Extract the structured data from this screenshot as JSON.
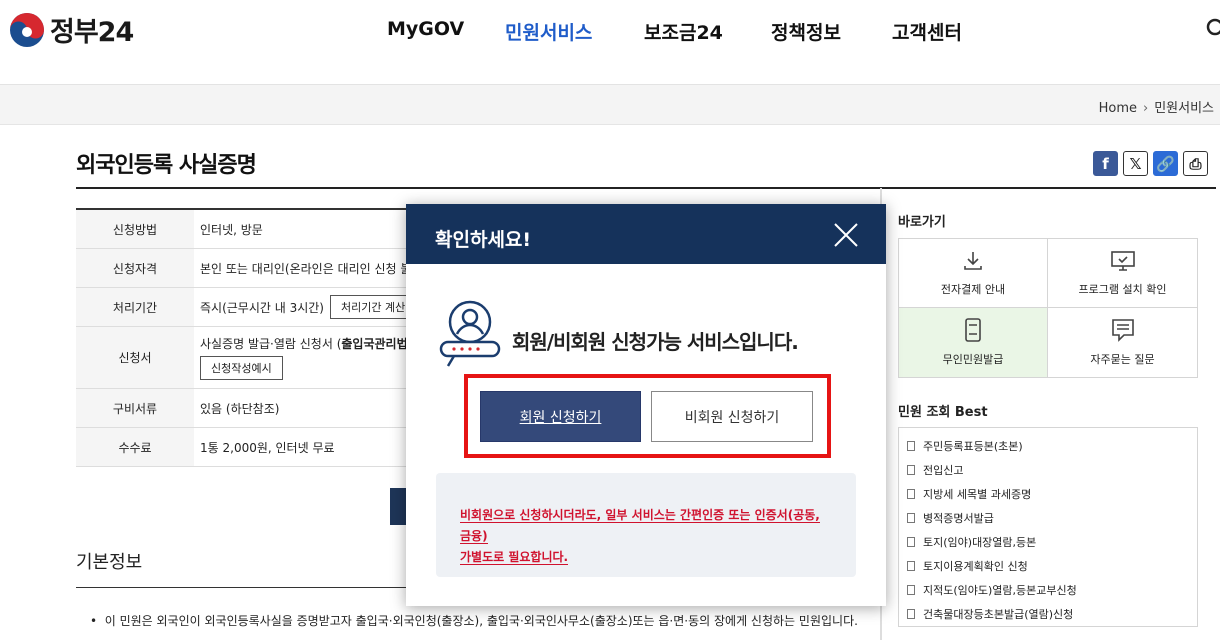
{
  "header": {
    "logo_text": "정부24",
    "nav": [
      {
        "label": "MyGOV"
      },
      {
        "label": "민원서비스"
      },
      {
        "label": "보조금24"
      },
      {
        "label": "정책정보"
      },
      {
        "label": "고객센터"
      }
    ]
  },
  "breadcrumb": {
    "home": "Home",
    "current": "민원서비스"
  },
  "page": {
    "title": "외국인등록 사실증명"
  },
  "info_table": [
    {
      "key": "신청방법",
      "value": "인터넷, 방문"
    },
    {
      "key": "신청자격",
      "value": "본인 또는 대리인(온라인은 대리인 신청 불가"
    },
    {
      "key": "처리기간",
      "value": "즉시(근무시간 내 3시간)",
      "button": "처리기간 계산방"
    },
    {
      "key": "신청서",
      "value_a": "사실증명 발급·열람 신청서 (",
      "value_b": "출입국관리법 시",
      "button": "신청작성예시"
    },
    {
      "key": "구비서류",
      "value": "있음 (하단참조)"
    },
    {
      "key": "수수료",
      "value": "1통 2,000원, 인터넷 무료"
    }
  ],
  "basic_info": {
    "heading": "기본정보",
    "bullet": "이 민원은 외국인이 외국인등록사실을 증명받고자 출입국·외국인청(출장소), 출입국·외국인사무소(출장소)또는 읍·면·동의 장에게 신청하는 민원입니다."
  },
  "sidebar": {
    "quick_title": "바로가기",
    "quick_links": [
      {
        "label": "전자결제 안내",
        "icon": "download-icon"
      },
      {
        "label": "프로그램 설치 확인",
        "icon": "monitor-icon"
      },
      {
        "label": "무인민원발급",
        "icon": "kiosk-icon"
      },
      {
        "label": "자주묻는 질문",
        "icon": "chat-icon"
      }
    ],
    "best_title": "민원 조회 Best",
    "best_items": [
      "주민등록표등본(초본)",
      "전입신고",
      "지방세 세목별 과세증명",
      "병적증명서발급",
      "토지(임야)대장열람,등본",
      "토지이용계획확인 신청",
      "지적도(임야도)열람,등본교부신청",
      "건축물대장등초본발급(열람)신청"
    ]
  },
  "modal": {
    "title": "확인하세요!",
    "message": "회원/비회원 신청가능 서비스입니다.",
    "member_button": "회원 신청하기",
    "guest_button": "비회원 신청하기",
    "note_line1": "비회원으로 신청하시더라도, 일부 서비스는 간편인증 또는 인증서(공동, 금융)",
    "note_line2": "가별도로 필요합니다."
  },
  "colors": {
    "brand_blue": "#1f5cc9",
    "modal_header": "#15325b",
    "alert_red": "#e61414",
    "member_button": "#34497a"
  }
}
